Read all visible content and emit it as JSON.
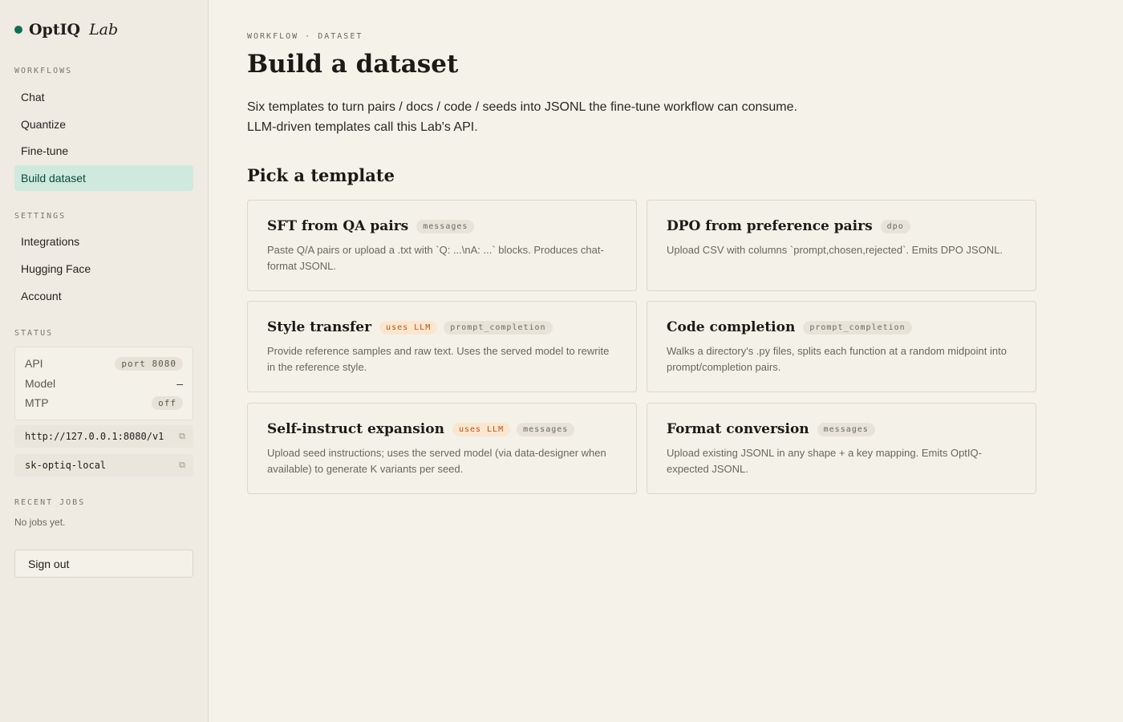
{
  "brand": {
    "name": "OptIQ",
    "suffix": "Lab",
    "accent": "#0f6e55"
  },
  "sidebar": {
    "workflows_label": "WORKFLOWS",
    "workflows": [
      "Chat",
      "Quantize",
      "Fine-tune",
      "Build dataset"
    ],
    "active_workflow": "Build dataset",
    "settings_label": "SETTINGS",
    "settings": [
      "Integrations",
      "Hugging Face",
      "Account"
    ],
    "status_label": "STATUS",
    "status": {
      "api_label": "API",
      "api_value": "port 8080",
      "model_label": "Model",
      "model_value": "–",
      "mtp_label": "MTP",
      "mtp_value": "off"
    },
    "endpoint": "http://127.0.0.1:8080/v1",
    "api_key": "sk-optiq-local",
    "recent_jobs_label": "RECENT JOBS",
    "recent_jobs_empty": "No jobs yet.",
    "signout_label": "Sign out"
  },
  "main": {
    "breadcrumb": "WORKFLOW · DATASET",
    "title": "Build a dataset",
    "description": "Six templates to turn pairs / docs / code / seeds into JSONL the fine-tune workflow can consume. LLM-driven templates call this Lab's API.",
    "section_title": "Pick a template",
    "templates": [
      {
        "title": "SFT from QA pairs",
        "tags": [
          "messages"
        ],
        "llm_label": "",
        "description": "Paste Q/A pairs or upload a .txt with `Q: ...\\nA: ...` blocks. Produces chat-format JSONL."
      },
      {
        "title": "DPO from preference pairs",
        "tags": [
          "dpo"
        ],
        "llm_label": "",
        "description": "Upload CSV with columns `prompt,chosen,rejected`. Emits DPO JSONL."
      },
      {
        "title": "Style transfer",
        "llm_label": "uses LLM",
        "tags": [
          "prompt_completion"
        ],
        "description": "Provide reference samples and raw text. Uses the served model to rewrite in the reference style."
      },
      {
        "title": "Code completion",
        "tags": [
          "prompt_completion"
        ],
        "llm_label": "",
        "description": "Walks a directory's .py files, splits each function at a random midpoint into prompt/completion pairs."
      },
      {
        "title": "Self-instruct expansion",
        "llm_label": "uses LLM",
        "tags": [
          "messages"
        ],
        "description": "Upload seed instructions; uses the served model (via data-designer when available) to generate K variants per seed."
      },
      {
        "title": "Format conversion",
        "tags": [
          "messages"
        ],
        "llm_label": "",
        "description": "Upload existing JSONL in any shape + a key mapping. Emits OptIQ-expected JSONL."
      }
    ]
  }
}
